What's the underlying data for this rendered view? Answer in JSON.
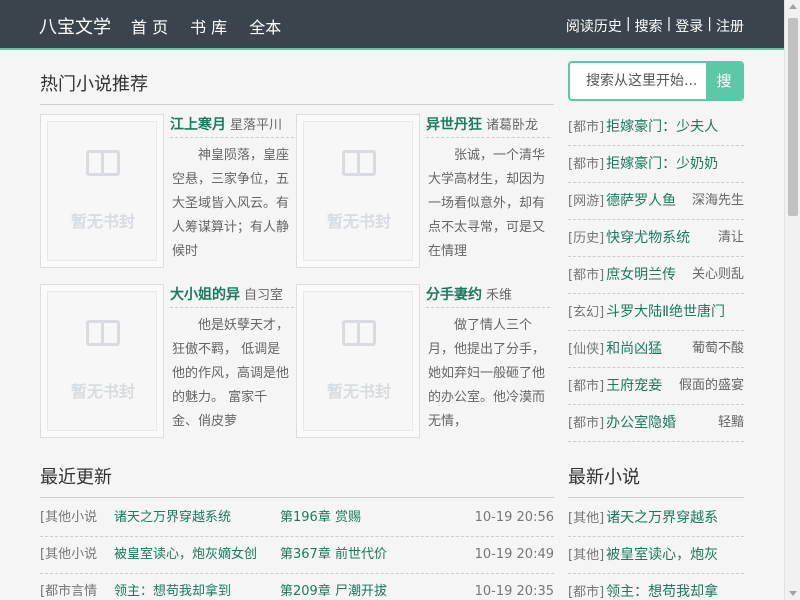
{
  "header": {
    "logo": "八宝文学",
    "nav": [
      "首 页",
      "书 库",
      "全本"
    ],
    "links": [
      "阅读历史",
      "搜索",
      "登录",
      "注册"
    ],
    "separator": "|"
  },
  "hot": {
    "title": "热门小说推荐",
    "cover_text": "暂无书封",
    "books": [
      {
        "title": "江上寒月",
        "author": "星落平川",
        "desc": "神皇陨落，皇座空悬，三家争位，五大圣域皆入风云。有人筹谋算计；有人静候时"
      },
      {
        "title": "异世丹狂",
        "author": "诸葛卧龙",
        "desc": "张诚，一个清华大学高材生，却因为一场看似意外，却有点不太寻常，可是又在情理"
      },
      {
        "title": "大小姐的异",
        "author": "自习室",
        "desc": "他是妖孽天才，狂傲不羁， 低调是他的作风，高调是他的魅力。 富家千金、俏皮萝"
      },
      {
        "title": "分手妻约",
        "author": "禾维",
        "desc": "做了情人三个月，他提出了分手，她如弃妇一般砸了他的办公室。他冷漠而无情，"
      }
    ]
  },
  "search": {
    "placeholder": "搜索从这里开始...",
    "button": "搜"
  },
  "side_list": [
    {
      "cat": "[都市]",
      "name": "拒嫁豪门：少夫人",
      "author": ""
    },
    {
      "cat": "[都市]",
      "name": "拒嫁豪门：少奶奶",
      "author": ""
    },
    {
      "cat": "[网游]",
      "name": "德萨罗人鱼",
      "author": "深海先生"
    },
    {
      "cat": "[历史]",
      "name": "快穿尤物系统",
      "author": "清让"
    },
    {
      "cat": "[都市]",
      "name": "庶女明兰传",
      "author": "关心则乱"
    },
    {
      "cat": "[玄幻]",
      "name": "斗罗大陆Ⅱ绝世唐门",
      "author": ""
    },
    {
      "cat": "[仙侠]",
      "name": "和尚凶猛",
      "author": "葡萄不酸"
    },
    {
      "cat": "[都市]",
      "name": "王府宠妾",
      "author": "假面的盛宴"
    },
    {
      "cat": "[都市]",
      "name": "办公室隐婚",
      "author": "轻黯"
    }
  ],
  "updates": {
    "title": "最近更新",
    "rows": [
      {
        "cat": "[其他小说",
        "name": "诸天之万界穿越系统",
        "chapter": "第196章 赏赐",
        "time": "10-19 20:56"
      },
      {
        "cat": "[其他小说",
        "name": "被皇室读心，炮灰嫡女创",
        "chapter": "第367章 前世代价",
        "time": "10-19 20:49"
      },
      {
        "cat": "[都市言情",
        "name": "领主：想苟我却拿到",
        "chapter": "第209章 尸潮开拔",
        "time": "10-19 20:35"
      }
    ]
  },
  "newest": {
    "title": "最新小说",
    "rows": [
      {
        "cat": "[其他]",
        "name": "诸天之万界穿越系"
      },
      {
        "cat": "[其他]",
        "name": "被皇室读心，炮灰"
      },
      {
        "cat": "[都市]",
        "name": "领主：想苟我却拿"
      }
    ]
  }
}
